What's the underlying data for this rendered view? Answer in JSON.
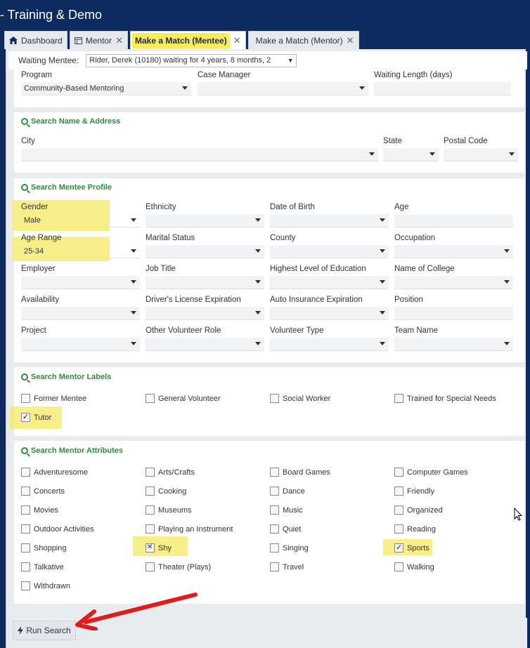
{
  "app": {
    "title": "- Training & Demo"
  },
  "tabs": [
    {
      "label": "Dashboard",
      "icon": "home-icon"
    },
    {
      "label": "Mentor",
      "icon": "grid-icon"
    },
    {
      "label": "Make a Match (Mentee)",
      "active": true
    },
    {
      "label": "Make a Match (Mentor)"
    }
  ],
  "waiting": {
    "label": "Waiting Mentee:",
    "value": "Rider, Derek (10180) waiting for 4 years, 8 months, 2"
  },
  "top_fields": {
    "program_label": "Program",
    "program_value": "Community-Based Mentoring",
    "case_manager_label": "Case Manager",
    "case_manager_value": "",
    "waiting_length_label": "Waiting Length (days)",
    "waiting_length_value": ""
  },
  "name_address": {
    "title": "Search Name & Address",
    "city_label": "City",
    "state_label": "State",
    "postal_label": "Postal Code"
  },
  "profile": {
    "title": "Search Mentee Profile",
    "fields": [
      {
        "label": "Gender",
        "value": "Male"
      },
      {
        "label": "Ethnicity",
        "value": ""
      },
      {
        "label": "Date of Birth",
        "value": ""
      },
      {
        "label": "Age",
        "value": ""
      },
      {
        "label": "Age Range",
        "value": "25-34"
      },
      {
        "label": "Marital Status",
        "value": ""
      },
      {
        "label": "County",
        "value": ""
      },
      {
        "label": "Occupation",
        "value": ""
      },
      {
        "label": "Employer",
        "value": ""
      },
      {
        "label": "Job Title",
        "value": ""
      },
      {
        "label": "Highest Level of Education",
        "value": ""
      },
      {
        "label": "Name of College",
        "value": ""
      },
      {
        "label": "Availability",
        "value": ""
      },
      {
        "label": "Driver's License Expiration",
        "value": ""
      },
      {
        "label": "Auto Insurance Expiration",
        "value": ""
      },
      {
        "label": "Position",
        "value": ""
      },
      {
        "label": "Project",
        "value": ""
      },
      {
        "label": "Other Volunteer Role",
        "value": ""
      },
      {
        "label": "Volunteer Type",
        "value": ""
      },
      {
        "label": "Team Name",
        "value": ""
      }
    ]
  },
  "labels_section": {
    "title": "Search Mentor Labels",
    "items": [
      {
        "label": "Former Mentee",
        "state": "unchecked"
      },
      {
        "label": "General Volunteer",
        "state": "unchecked"
      },
      {
        "label": "Social Worker",
        "state": "unchecked"
      },
      {
        "label": "Trained for Special Needs",
        "state": "unchecked"
      },
      {
        "label": "Tutor",
        "state": "checked"
      }
    ]
  },
  "attributes_section": {
    "title": "Search Mentor Attributes",
    "items": [
      {
        "label": "Adventuresome",
        "state": "unchecked"
      },
      {
        "label": "Arts/Crafts",
        "state": "unchecked"
      },
      {
        "label": "Board Games",
        "state": "unchecked"
      },
      {
        "label": "Computer Games",
        "state": "unchecked"
      },
      {
        "label": "Concerts",
        "state": "unchecked"
      },
      {
        "label": "Cooking",
        "state": "unchecked"
      },
      {
        "label": "Dance",
        "state": "unchecked"
      },
      {
        "label": "Friendly",
        "state": "unchecked"
      },
      {
        "label": "Movies",
        "state": "unchecked"
      },
      {
        "label": "Museums",
        "state": "unchecked"
      },
      {
        "label": "Music",
        "state": "unchecked"
      },
      {
        "label": "Organized",
        "state": "unchecked"
      },
      {
        "label": "Outdoor Activities",
        "state": "unchecked"
      },
      {
        "label": "Playing an Instrument",
        "state": "unchecked"
      },
      {
        "label": "Quiet",
        "state": "unchecked"
      },
      {
        "label": "Reading",
        "state": "unchecked"
      },
      {
        "label": "Shopping",
        "state": "unchecked"
      },
      {
        "label": "Shy",
        "state": "excluded"
      },
      {
        "label": "Singing",
        "state": "unchecked"
      },
      {
        "label": "Sports",
        "state": "checked"
      },
      {
        "label": "Talkative",
        "state": "unchecked"
      },
      {
        "label": "Theater (Plays)",
        "state": "unchecked"
      },
      {
        "label": "Travel",
        "state": "unchecked"
      },
      {
        "label": "Walking",
        "state": "unchecked"
      },
      {
        "label": "Withdrawn",
        "state": "unchecked"
      }
    ]
  },
  "run": {
    "label": "Run Search",
    "icon": "bolt-icon"
  },
  "colors": {
    "navy": "#0d2b5e",
    "green": "#2e8b3d",
    "highlight": "#f5ea63",
    "arrow": "#e01c1c"
  }
}
